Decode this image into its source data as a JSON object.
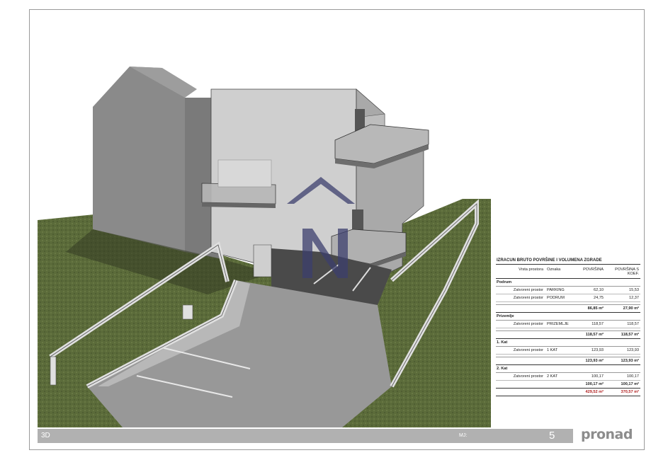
{
  "table": {
    "title": "IZRACUN BRUTO POVRŠINE I VOLUMENA ZGRADE",
    "headers": [
      "Vrsta prostora",
      "Oznaka",
      "POVRŠINA",
      "POVRŠINA S KOEF."
    ],
    "sections": [
      {
        "name": "Podrum",
        "rows": [
          {
            "type": "Zatvoreni prostor",
            "code": "PARKING",
            "area": "62,10",
            "coef": "15,53"
          },
          {
            "type": "Zatvoreni prostor",
            "code": "PODRUM",
            "area": "24,75",
            "coef": "12,37"
          }
        ],
        "subtotal": {
          "area": "86,85 m²",
          "coef": "27,90 m²"
        }
      },
      {
        "name": "Prizemlje",
        "rows": [
          {
            "type": "Zatvoreni prostor",
            "code": "PRIZEMLJE",
            "area": "118,57",
            "coef": "118,57"
          }
        ],
        "subtotal": {
          "area": "118,57 m²",
          "coef": "118,57 m²"
        }
      },
      {
        "name": "1. Kat",
        "rows": [
          {
            "type": "Zatvoreni prostor",
            "code": "1 KAT",
            "area": "123,93",
            "coef": "123,93"
          }
        ],
        "subtotal": {
          "area": "123,93 m²",
          "coef": "123,93 m²"
        }
      },
      {
        "name": "2. Kat",
        "rows": [
          {
            "type": "Zatvoreni prostor",
            "code": "2 KAT",
            "area": "100,17",
            "coef": "100,17"
          }
        ],
        "subtotal": {
          "area": "100,17 m²",
          "coef": "100,17 m²"
        }
      }
    ],
    "total": {
      "area": "429,52 m²",
      "coef": "370,57 m²"
    }
  },
  "footer": {
    "view": "3D",
    "mj": "MJ:",
    "page": "5"
  },
  "logo": {
    "pre": "pro",
    "post": "nad"
  },
  "colors": {
    "grass": "#5a6a38",
    "footer": "#b1b1b1",
    "total": "#b02020",
    "watermark": "#3c3f6e"
  }
}
